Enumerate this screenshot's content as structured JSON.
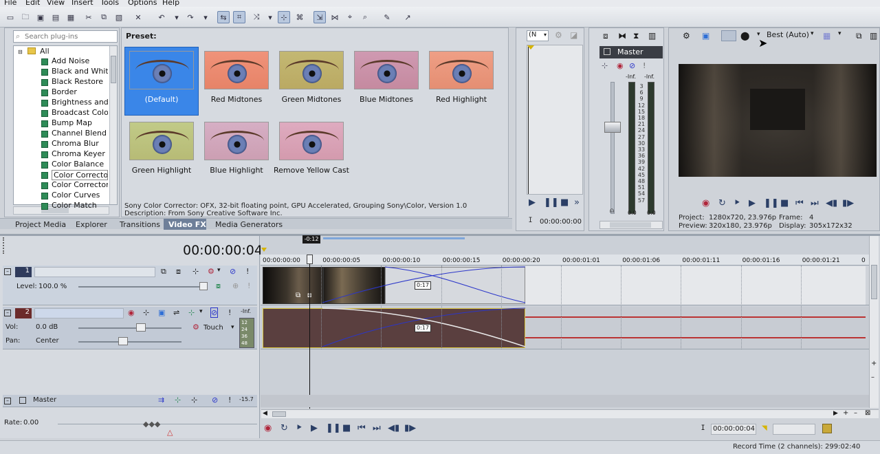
{
  "menu": [
    "File",
    "Edit",
    "View",
    "Insert",
    "Tools",
    "Options",
    "Help"
  ],
  "plugin_search": {
    "placeholder": "Search plug-ins"
  },
  "plugin_tree": {
    "root": "All",
    "items": [
      "Add Noise",
      "Black and White",
      "Black Restore",
      "Border",
      "Brightness and Co",
      "Broadcast Colors",
      "Bump Map",
      "Channel Blend",
      "Chroma Blur",
      "Chroma Keyer",
      "Color Balance",
      "Color Corrector",
      "Color Corrector (S",
      "Color Curves",
      "Color Match"
    ],
    "selected": "Color Corrector"
  },
  "preset": {
    "heading": "Preset:",
    "items": [
      "(Default)",
      "Red Midtones",
      "Green Midtones",
      "Blue Midtones",
      "Red Highlight",
      "Green Highlight",
      "Blue Highlight",
      "Remove Yellow Cast"
    ],
    "selected": "(Default)",
    "info_line1": "Sony Color Corrector: OFX, 32-bit floating point, GPU Accelerated, Grouping Sony\\Color, Version 1.0",
    "info_line2": "Description: From Sony Creative Software Inc."
  },
  "window_tabs": [
    "Project Media",
    "Explorer",
    "Transitions",
    "Video FX",
    "Media Generators"
  ],
  "active_tab": "Video FX",
  "trimmer": {
    "dropdown": "(N",
    "timecode": "00:00:00:00"
  },
  "master_bus": {
    "label": "Master",
    "peak_left": "-Inf.",
    "peak_right": "-Inf.",
    "scale": [
      "3",
      "6",
      "9",
      "12",
      "15",
      "18",
      "21",
      "24",
      "27",
      "30",
      "33",
      "36",
      "39",
      "42",
      "45",
      "48",
      "51",
      "54",
      "57"
    ],
    "value_left": "0.0",
    "value_right": "0.0"
  },
  "preview": {
    "quality": "Best (Auto)",
    "project_label": "Project:",
    "project_value": "1280x720, 23.976p",
    "preview_label": "Preview:",
    "preview_value": "320x180, 23.976p",
    "frame_label": "Frame:",
    "frame_value": "4",
    "display_label": "Display:",
    "display_value": "305x172x32"
  },
  "timeline": {
    "cursor_time": "00:00:00:04",
    "region_badge": "-0:12",
    "ruler": [
      "00:00:00:00",
      "00:00:00:05",
      "00:00:00:10",
      "00:00:00:15",
      "00:00:00:20",
      "00:00:01:01",
      "00:00:01:06",
      "00:00:01:11",
      "00:00:01:16",
      "00:00:01:21",
      "0"
    ],
    "crossfade_label": "0:17",
    "crossfade_label_audio": "0:17"
  },
  "tracks": {
    "video": {
      "number": "1",
      "level_label": "Level:",
      "level_value": "100.0 %"
    },
    "audio": {
      "number": "2",
      "peak": "-Inf.",
      "vol_label": "Vol:",
      "vol_value": "0.0 dB",
      "pan_label": "Pan:",
      "pan_value": "Center",
      "automation": "Touch",
      "meter_ticks": [
        "12",
        "24",
        "36",
        "48"
      ]
    },
    "master": {
      "label": "Master",
      "peak": "-15.7"
    }
  },
  "rate": {
    "label": "Rate:",
    "value": "0.00"
  },
  "transport": {
    "timecode": "00:00:00:04"
  },
  "status": {
    "record_time": "Record Time (2 channels): 299:02:40"
  },
  "colors": {
    "accent": "#2f6fd6",
    "selection": "#3a86e8",
    "track_audio": "#5a3f3f",
    "envelope": "#2b36c9",
    "playhead": "#111111"
  }
}
